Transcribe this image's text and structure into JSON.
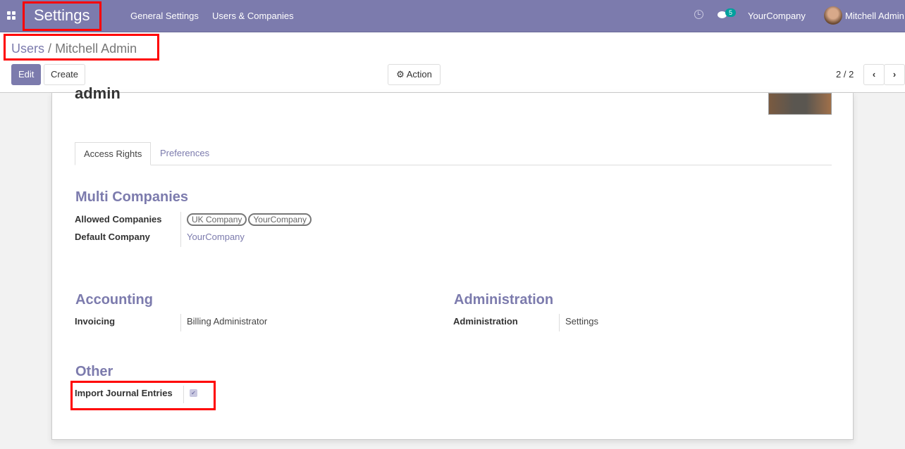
{
  "navbar": {
    "app": "Settings",
    "menu": [
      "General Settings",
      "Users & Companies"
    ],
    "message_count": "5",
    "company": "YourCompany",
    "user": "Mitchell Admin"
  },
  "breadcrumb": {
    "parent": "Users",
    "separator": "/",
    "current": "Mitchell Admin"
  },
  "toolbar": {
    "edit": "Edit",
    "create": "Create",
    "action": "Action",
    "pager": "2 / 2"
  },
  "record": {
    "name_partial": "admin"
  },
  "tabs": [
    "Access Rights",
    "Preferences"
  ],
  "multi_companies": {
    "title": "Multi Companies",
    "allowed_label": "Allowed Companies",
    "allowed": [
      "UK Company",
      "YourCompany"
    ],
    "default_label": "Default Company",
    "default": "YourCompany"
  },
  "accounting": {
    "title": "Accounting",
    "label": "Invoicing",
    "value": "Billing Administrator"
  },
  "administration": {
    "title": "Administration",
    "label": "Administration",
    "value": "Settings"
  },
  "other": {
    "title": "Other",
    "label": "Import Journal Entries",
    "checked": true
  },
  "colors": {
    "brand": "#7c7bad",
    "badge": "#00a09d",
    "highlight": "#ff0000"
  }
}
